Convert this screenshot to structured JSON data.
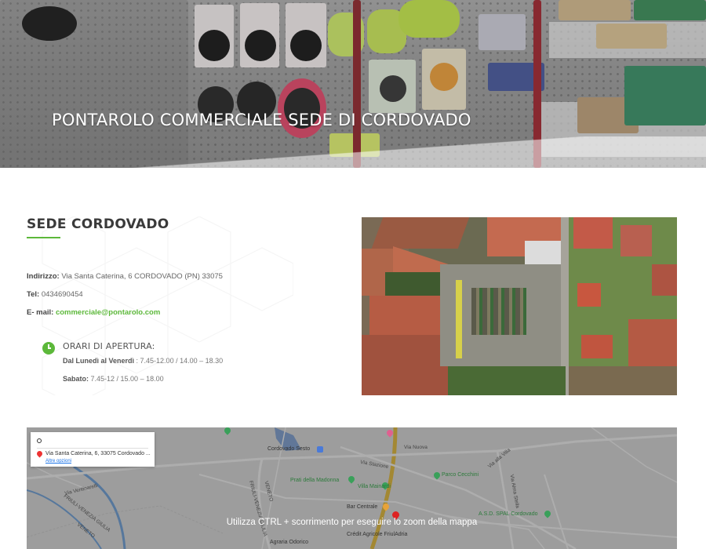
{
  "hero": {
    "title": "PONTAROLO COMMERCIALE SEDE DI CORDOVADO"
  },
  "sede": {
    "title": "SEDE CORDOVADO",
    "address_label": "Indirizzo:",
    "address_value": " Via Santa Caterina, 6 CORDOVADO (PN) 33075",
    "phone_label": "Tel:",
    "phone_value": " 0434690454",
    "email_label": "E- mail:",
    "email_value": "commerciale@pontarolo.com",
    "hours_title": "ORARI DI APERTURA:",
    "weekday_label": "Dal Lunedì al Venerdì",
    "weekday_hours": " : 7.45-12.00 / 14.00 – 18.30",
    "saturday_label": "Sabato:",
    "saturday_hours": "  7.45-12 / 15.00 – 18.00"
  },
  "map": {
    "infobox_address": "Via Santa Caterina, 6, 33075 Cordovado ...",
    "infobox_more": "Altre opzioni",
    "scroll_message": "Utilizza CTRL + scorrimento per eseguire lo zoom della mappa",
    "labels": {
      "cordovado_sesto": "Cordovado Sesto",
      "via_nuova": "Via Nuova",
      "via_stazione": "Via Stazione",
      "prati_madonna": "Prati della Madonna",
      "villa_mainardi": "Villa Mainardi",
      "parco_cecchini": "Parco Cecchini",
      "bar_centrale": "Bar Centrale",
      "asd_spal": "A.S.D. SPAL Cordovado",
      "via_ventinarelli": "Via Ventinarelli",
      "friuli_vg_1": "FRIULI-VENEZIA GIULIA",
      "friuli_vg_2": "FRIULI-VENEZIA GIULIA",
      "veneto_1": "VENETO",
      "veneto_2": "VENETO",
      "credit_agricole": "Crédit Agricole FriulAdria",
      "agraria": "Agraria Odorico",
      "via_alla_villa": "Via alla Villa",
      "via_alma_stella": "Via Alma Stella"
    }
  },
  "colors": {
    "accent_green": "#5cb83a",
    "heading_text": "#3a3a3a",
    "body_text": "#666666"
  },
  "icons": {
    "clock": "clock-icon",
    "map_pin": "map-pin-icon"
  }
}
